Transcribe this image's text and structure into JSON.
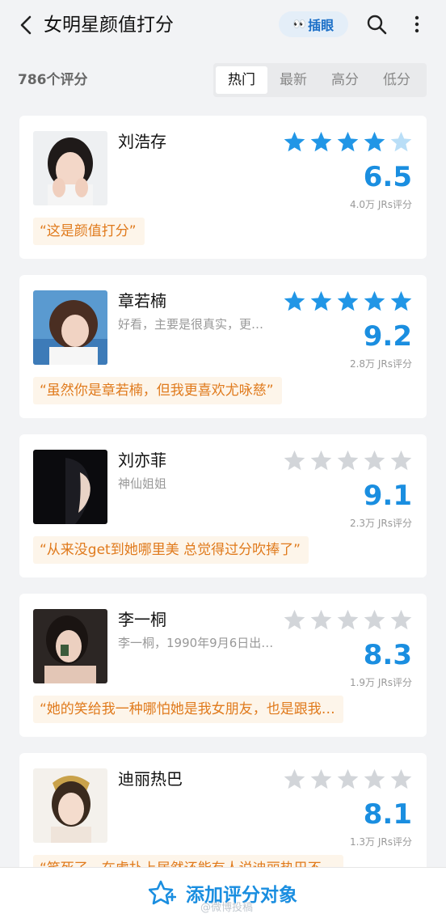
{
  "header": {
    "back_icon": "chevron-left-icon",
    "title": "女明星颜值打分",
    "peek_icon": "eyes-icon",
    "peek_label": "插眼",
    "search_icon": "search-icon",
    "more_icon": "more-vertical-icon"
  },
  "summary": {
    "count_label": "786个评分"
  },
  "sort_tabs": [
    {
      "label": "热门",
      "active": true
    },
    {
      "label": "最新",
      "active": false
    },
    {
      "label": "高分",
      "active": false
    },
    {
      "label": "低分",
      "active": false
    }
  ],
  "items": [
    {
      "name": "刘浩存",
      "subtitle": "",
      "stars": 4.5,
      "star_color": "blue",
      "score": "6.5",
      "votes": "4.0万 JRs评分",
      "quote": "“这是颜值打分”"
    },
    {
      "name": "章若楠",
      "subtitle": "好看，主要是很真实，更…",
      "stars": 5,
      "star_color": "blue",
      "score": "9.2",
      "votes": "2.8万 JRs评分",
      "quote": "“虽然你是章若楠，但我更喜欢尤咏慈”"
    },
    {
      "name": "刘亦菲",
      "subtitle": "神仙姐姐",
      "stars": 0,
      "star_color": "gray",
      "score": "9.1",
      "votes": "2.3万 JRs评分",
      "quote": "“从来没get到她哪里美 总觉得过分吹捧了”"
    },
    {
      "name": "李一桐",
      "subtitle": "李一桐，1990年9月6日出…",
      "stars": 0,
      "star_color": "gray",
      "score": "8.3",
      "votes": "1.9万 JRs评分",
      "quote": "“她的笑给我一种哪怕她是我女朋友，也是跟我…"
    },
    {
      "name": "迪丽热巴",
      "subtitle": "",
      "stars": 0,
      "star_color": "gray",
      "score": "8.1",
      "votes": "1.3万 JRs评分",
      "quote": "“笑死了，在虎扑上居然还能有人说迪丽热巴不…"
    }
  ],
  "footer": {
    "add_icon": "star-plus-icon",
    "add_label": "添加评分对象",
    "watermark": "@微博投稿"
  },
  "colors": {
    "accent": "#1a8ee0",
    "star_active": "#2196e6",
    "star_half": "#b9def7",
    "star_inactive": "#d2d5d9",
    "quote_text": "#e07a1c",
    "quote_bg": "#fdf5ea"
  }
}
